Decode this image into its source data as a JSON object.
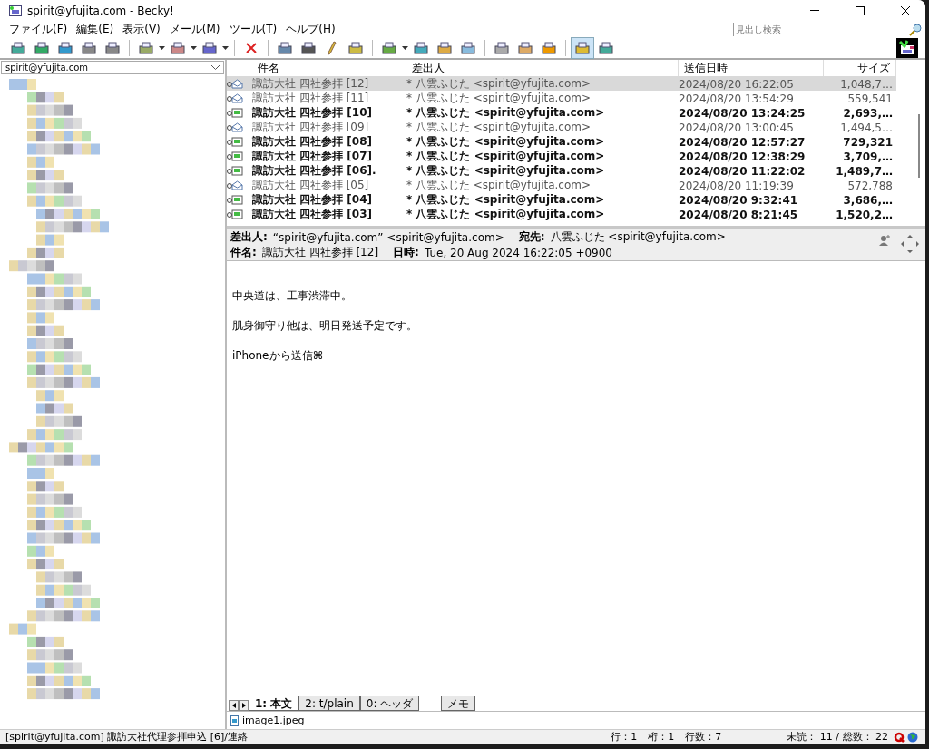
{
  "window": {
    "title": "spirit@yfujita.com - Becky!"
  },
  "menu": [
    "ファイル(F)",
    "編集(E)",
    "表示(V)",
    "メール(M)",
    "ツール(T)",
    "ヘルプ(H)"
  ],
  "search": {
    "placeholder": "見出し検索"
  },
  "folder_selector": {
    "value": "spirit@yfujita.com"
  },
  "message_list": {
    "columns": [
      "件名",
      "差出人",
      "送信日時",
      "サイズ"
    ],
    "rows": [
      {
        "subject": "諏訪大社 四社参拝 [12]",
        "from": "* 八雲ふじた <spirit@yfujita.com>",
        "date": "2024/08/20 16:22:05",
        "size": "1,048,7…",
        "unread": false,
        "selected": true
      },
      {
        "subject": "諏訪大社 四社参拝 [11]",
        "from": "* 八雲ふじた <spirit@yfujita.com>",
        "date": "2024/08/20 13:54:29",
        "size": "559,541",
        "unread": false,
        "selected": false
      },
      {
        "subject": "諏訪大社 四社参拝 [10]",
        "from": "* 八雲ふじた <spirit@yfujita.com>",
        "date": "2024/08/20 13:24:25",
        "size": "2,693,…",
        "unread": true,
        "selected": false
      },
      {
        "subject": "諏訪大社 四社参拝 [09]",
        "from": "* 八雲ふじた <spirit@yfujita.com>",
        "date": "2024/08/20 13:00:45",
        "size": "1,494,5…",
        "unread": false,
        "selected": false
      },
      {
        "subject": "諏訪大社 四社参拝 [08]",
        "from": "* 八雲ふじた <spirit@yfujita.com>",
        "date": "2024/08/20 12:57:27",
        "size": "729,321",
        "unread": true,
        "selected": false
      },
      {
        "subject": "諏訪大社 四社参拝 [07]",
        "from": "* 八雲ふじた <spirit@yfujita.com>",
        "date": "2024/08/20 12:38:29",
        "size": "3,709,…",
        "unread": true,
        "selected": false
      },
      {
        "subject": "諏訪大社 四社参拝 [06].",
        "from": "* 八雲ふじた <spirit@yfujita.com>",
        "date": "2024/08/20 11:22:02",
        "size": "1,489,7…",
        "unread": true,
        "selected": false
      },
      {
        "subject": "諏訪大社 四社参拝 [05]",
        "from": "* 八雲ふじた <spirit@yfujita.com>",
        "date": "2024/08/20 11:19:39",
        "size": "572,788",
        "unread": false,
        "selected": false
      },
      {
        "subject": "諏訪大社 四社参拝 [04]",
        "from": "* 八雲ふじた <spirit@yfujita.com>",
        "date": "2024/08/20 9:32:41",
        "size": "3,686,…",
        "unread": true,
        "selected": false
      },
      {
        "subject": "諏訪大社 四社参拝 [03]",
        "from": "* 八雲ふじた <spirit@yfujita.com>",
        "date": "2024/08/20 8:21:45",
        "size": "1,520,2…",
        "unread": true,
        "selected": false
      }
    ]
  },
  "header": {
    "from_label": "差出人:",
    "from": "“spirit@yfujita.com” <spirit@yfujita.com>",
    "to_label": "宛先:",
    "to": "八雲ふじた <spirit@yfujita.com>",
    "subject_label": "件名:",
    "subject": "諏訪大社 四社参拝 [12]",
    "date_label": "日時:",
    "date": "Tue, 20 Aug 2024 16:22:05 +0900"
  },
  "body": [
    "中央道は、工事渋滞中。",
    "肌身御守り他は、明日発送予定です。",
    "iPhoneから送信⌘"
  ],
  "tabs": [
    {
      "label": "1: 本文",
      "selected": true
    },
    {
      "label": "2: t/plain",
      "selected": false
    },
    {
      "label": "0: ヘッダ",
      "selected": false
    },
    {
      "label": "メモ",
      "selected": false
    }
  ],
  "attachments": [
    "image1.jpeg"
  ],
  "status_bar": {
    "folder": "[spirit@yfujita.com] 諏訪大社代理参拝申込 [6]/連絡",
    "line": "行：1",
    "column": "桁：1",
    "line_count": "行数：7",
    "counts": "未読： 11 / 総数： 22"
  }
}
